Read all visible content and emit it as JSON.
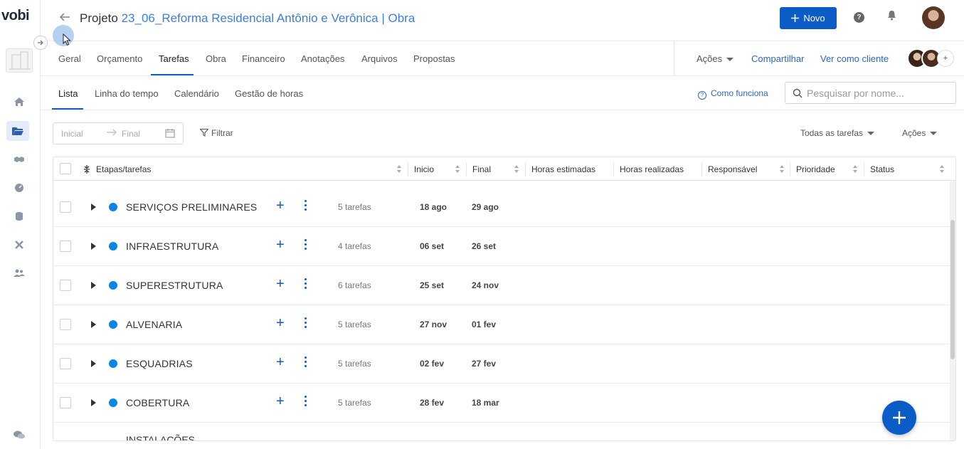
{
  "app": {
    "logo": "vobi"
  },
  "header": {
    "title_prefix": "Projeto ",
    "project_name": "23_06_Reforma Residencial Antônio e Verônica | Obra",
    "new_button": "Novo",
    "help": "?"
  },
  "main_tabs": [
    "Geral",
    "Orçamento",
    "Tarefas",
    "Obra",
    "Financeiro",
    "Anotações",
    "Arquivos",
    "Propostas"
  ],
  "main_tabs_active": "Tarefas",
  "right_actions": {
    "acoes": "Ações",
    "share": "Compartilhar",
    "client_view": "Ver como cliente",
    "add_member": "+"
  },
  "sub_tabs": [
    "Lista",
    "Linha do tempo",
    "Calendário",
    "Gestão de horas"
  ],
  "sub_tabs_active": "Lista",
  "how_it_works": "Como funciona",
  "search": {
    "placeholder": "Pesquisar por nome...",
    "value": ""
  },
  "filters": {
    "start_placeholder": "Inicial",
    "end_placeholder": "Final",
    "filter_button": "Filtrar",
    "all_tasks": "Todas as tarefas",
    "actions": "Ações"
  },
  "table": {
    "columns": [
      "Etapas/tarefas",
      "Inicio",
      "Final",
      "Horas estimadas",
      "Horas realizadas",
      "Responsável",
      "Prioridade",
      "Status"
    ],
    "rows": [
      {
        "name": "SERVIÇOS PRELIMINARES",
        "count": "5 tarefas",
        "start": "18 ago",
        "end": "29 ago"
      },
      {
        "name": "INFRAESTRUTURA",
        "count": "4 tarefas",
        "start": "06 set",
        "end": "26 set"
      },
      {
        "name": "SUPERESTRUTURA",
        "count": "6 tarefas",
        "start": "25 set",
        "end": "24 nov"
      },
      {
        "name": "ALVENARIA",
        "count": "5 tarefas",
        "start": "27 nov",
        "end": "01 fev"
      },
      {
        "name": "ESQUADRIAS",
        "count": "5 tarefas",
        "start": "02 fev",
        "end": "27 fev"
      },
      {
        "name": "COBERTURA",
        "count": "5 tarefas",
        "start": "28 fev",
        "end": "18 mar"
      }
    ],
    "partial_row": "INSTALAÇÕES"
  },
  "colors": {
    "primary": "#0b5cc7",
    "link": "#2a66c6",
    "stage_dot": "#0b84e8"
  }
}
